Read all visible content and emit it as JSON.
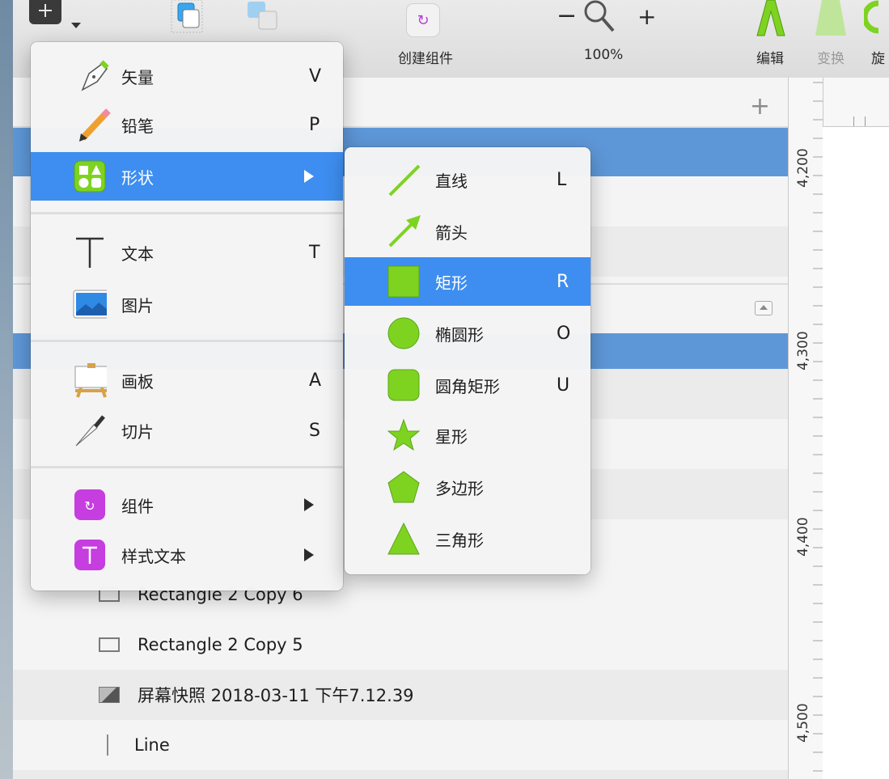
{
  "toolbar": {
    "create_symbol_label": "创建组件",
    "zoom_label": "100%",
    "zoom_minus": "−",
    "zoom_plus": "+",
    "edit_label": "编辑",
    "transform_label": "变换",
    "rotate_label": "旋"
  },
  "insert_menu": {
    "items": [
      {
        "label": "矢量",
        "key": "V",
        "icon": "vector-pen-icon"
      },
      {
        "label": "铅笔",
        "key": "P",
        "icon": "pencil-icon"
      },
      {
        "label": "形状",
        "key": "",
        "icon": "shapes-icon",
        "highlighted": true,
        "submenu": true
      },
      {
        "label": "文本",
        "key": "T",
        "icon": "text-icon"
      },
      {
        "label": "图片",
        "key": "",
        "icon": "image-icon"
      },
      {
        "label": "画板",
        "key": "A",
        "icon": "artboard-icon"
      },
      {
        "label": "切片",
        "key": "S",
        "icon": "slice-knife-icon"
      },
      {
        "label": "组件",
        "key": "",
        "icon": "symbol-icon",
        "submenu": true
      },
      {
        "label": "样式文本",
        "key": "",
        "icon": "styled-text-icon",
        "submenu": true
      }
    ]
  },
  "shape_menu": {
    "items": [
      {
        "label": "直线",
        "key": "L",
        "icon": "line-icon"
      },
      {
        "label": "箭头",
        "key": "",
        "icon": "arrow-icon"
      },
      {
        "label": "矩形",
        "key": "R",
        "icon": "rectangle-icon",
        "highlighted": true
      },
      {
        "label": "椭圆形",
        "key": "O",
        "icon": "oval-icon"
      },
      {
        "label": "圆角矩形",
        "key": "U",
        "icon": "rounded-rectangle-icon"
      },
      {
        "label": "星形",
        "key": "",
        "icon": "star-icon"
      },
      {
        "label": "多边形",
        "key": "",
        "icon": "polygon-icon"
      },
      {
        "label": "三角形",
        "key": "",
        "icon": "triangle-icon"
      }
    ]
  },
  "layers": {
    "visible_rows": [
      {
        "label": "Rectangle 2 Copy 6",
        "type": "rect"
      },
      {
        "label": "Rectangle 2 Copy 5",
        "type": "rect"
      },
      {
        "label": "屏幕快照 2018-03-11 下午7.12.39",
        "type": "image"
      },
      {
        "label": "Line",
        "type": "line"
      }
    ]
  },
  "ruler": {
    "marks": [
      "4,200",
      "4,300",
      "4,400",
      "4,500"
    ]
  },
  "colors": {
    "menu_highlight": "#3d8ef0",
    "layer_selection": "#5e97d8",
    "shape_green": "#7ed321"
  }
}
